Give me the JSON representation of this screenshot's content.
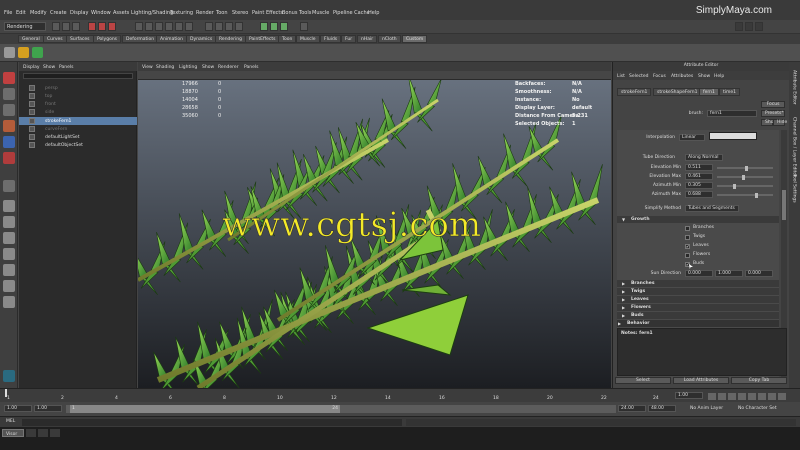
{
  "menubar": {
    "items": [
      "File",
      "Edit",
      "Modify",
      "Create",
      "Display",
      "Window",
      "Assets",
      "Lighting/Shading",
      "Texturing",
      "Render",
      "Toon",
      "Stereo",
      "Paint Effects",
      "Bonus Tools",
      "Muscle",
      "Pipeline Cache",
      "Help"
    ],
    "brand": "SimplyMaya.com"
  },
  "statusline": {
    "mode": "Rendering"
  },
  "shelf": {
    "tabs": [
      "General",
      "Curves",
      "Surfaces",
      "Polygons",
      "Deformation",
      "Animation",
      "Dynamics",
      "Rendering",
      "PaintEffects",
      "Toon",
      "Muscle",
      "Fluids",
      "Fur",
      "nHair",
      "nCloth",
      "Custom"
    ],
    "active_tab": "Custom"
  },
  "outliner": {
    "menu": [
      "Display",
      "Show",
      "Panels"
    ],
    "items": [
      "persp",
      "top",
      "front",
      "side",
      "strokeFern1",
      "curveFern",
      "defaultLightSet",
      "defaultObjectSet"
    ],
    "selected": "strokeFern1"
  },
  "viewport": {
    "menu": [
      "View",
      "Shading",
      "Lighting",
      "Show",
      "Renderer",
      "Panels"
    ],
    "hud": {
      "labels": [
        "Backfaces:",
        "Smoothness:",
        "Instance:",
        "Display Layer:",
        "Distance From Camera:",
        "Selected Objects:"
      ],
      "values": [
        "N/A",
        "N/A",
        "No",
        "default",
        "5.231",
        "1"
      ]
    },
    "stats": {
      "numbers": [
        "17966",
        "18870",
        "14004",
        "28658",
        "35060"
      ],
      "zeros": [
        "0",
        "0",
        "0",
        "0",
        "0"
      ]
    },
    "watermark": "www.cgtsj.com"
  },
  "attr_editor": {
    "title": "Attribute Editor",
    "menu": [
      "List",
      "Selected",
      "Focus",
      "Attributes",
      "Show",
      "Help"
    ],
    "tabs": [
      "strokeFern1",
      "strokeShapeFern1",
      "fern1",
      "time1"
    ],
    "active_tab": "fern1",
    "brush_label": "brush:",
    "brush_value": "fern1",
    "buttons": {
      "focus": "Focus",
      "presets": "Presets*",
      "show": "Show",
      "hide": "Hide"
    },
    "interpolation_label": "Interpolation",
    "interpolation_value": "Linear",
    "tube_direction_label": "Tube Direction",
    "tube_direction_value": "Along Normal",
    "elevation_min_label": "Elevation Min",
    "elevation_min": "0.511",
    "elevation_max_label": "Elevation Max",
    "elevation_max": "0.461",
    "azimuth_min_label": "Azimuth Min",
    "azimuth_min": "0.305",
    "azimuth_max_label": "Azimuth Max",
    "azimuth_max": "0.688",
    "simplify_label": "Simplify Method",
    "simplify_value": "Tubes and Segments",
    "growth_label": "Growth",
    "growth_items": [
      "Branches",
      "Twigs",
      "Leaves",
      "Flowers",
      "Buds"
    ],
    "growth_checked": [
      "Leaves",
      "Buds"
    ],
    "sun_label": "Sun Direction",
    "sun_values": [
      "0.000",
      "1.000",
      "0.000"
    ],
    "sections": [
      "Branches",
      "Twigs",
      "Leaves",
      "Flowers",
      "Buds",
      "Behavior"
    ],
    "notes": "Notes: fern1",
    "footer_buttons": [
      "Select",
      "Load Attributes",
      "Copy Tab"
    ]
  },
  "vstrip": {
    "labels": [
      "Attribute Editor",
      "Channel Box / Layer Editor",
      "Tool Settings"
    ]
  },
  "timeline": {
    "ticks": [
      "1",
      "2",
      "4",
      "6",
      "8",
      "10",
      "12",
      "14",
      "16",
      "18",
      "20",
      "22",
      "24"
    ],
    "current_frame": "1.00"
  },
  "range": {
    "start": "1.00",
    "start2": "1.00",
    "start_marker": "1",
    "end_marker": "24",
    "end": "24.00",
    "end2": "48.00",
    "anim_layer": "No Anim Layer",
    "char_set": "No Character Set"
  },
  "cmdline": {
    "label": "MEL"
  },
  "taskbar": {
    "item": "Visor"
  }
}
